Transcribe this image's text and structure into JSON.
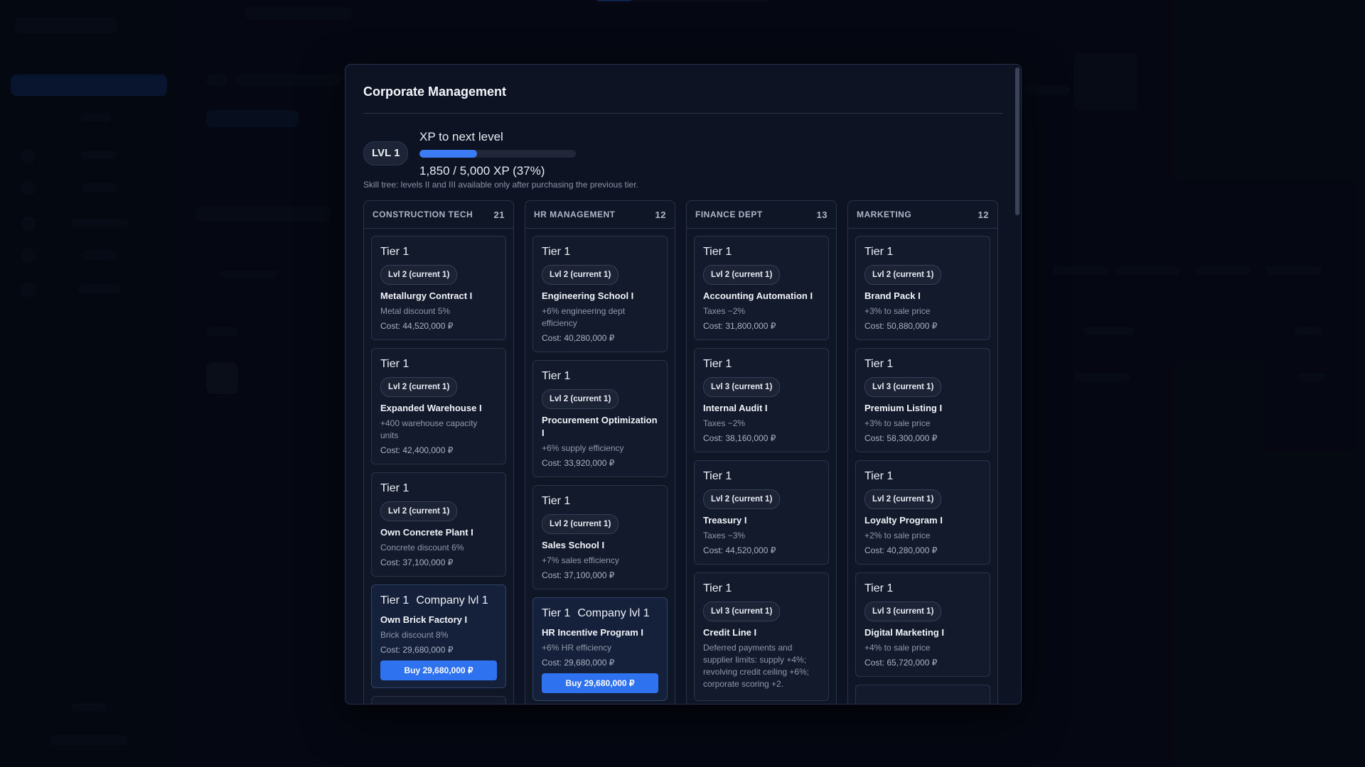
{
  "modal": {
    "title": "Corporate Management",
    "level_badge": "LVL 1",
    "xp_label": "XP to next level",
    "xp_value": "1,850 / 5,000 XP (37%)",
    "xp_progress": 0.37,
    "skill_note": "Skill tree: levels II and III available only after purchasing the previous tier."
  },
  "colors": {
    "accent": "#3b7cf5",
    "buy_button": "#2f72f0",
    "modal_bg": "#0d1322"
  },
  "columns": [
    {
      "title": "CONSTRUCTION TECH",
      "count": "21",
      "cards": [
        {
          "tier": "Tier 1",
          "badge": "Lvl 2 (current 1)",
          "name": "Metallurgy Contract I",
          "desc": "Metal discount 5%",
          "cost": "Cost: 44,520,000 ₽"
        },
        {
          "tier": "Tier 1",
          "badge": "Lvl 2 (current 1)",
          "name": "Expanded Warehouse I",
          "desc": "+400 warehouse capacity units",
          "cost": "Cost: 42,400,000 ₽"
        },
        {
          "tier": "Tier 1",
          "badge": "Lvl 2 (current 1)",
          "name": "Own Concrete Plant I",
          "desc": "Concrete discount 6%",
          "cost": "Cost: 37,100,000 ₽"
        },
        {
          "tier": "Tier 1",
          "company": "Company lvl 1",
          "name": "Own Brick Factory I",
          "desc": "Brick discount 8%",
          "cost": "Cost: 29,680,000 ₽",
          "buy": "Buy 29,680,000 ₽"
        }
      ]
    },
    {
      "title": "HR MANAGEMENT",
      "count": "12",
      "cards": [
        {
          "tier": "Tier 1",
          "badge": "Lvl 2 (current 1)",
          "name": "Engineering School I",
          "desc": "+6% engineering dept efficiency",
          "cost": "Cost: 40,280,000 ₽"
        },
        {
          "tier": "Tier 1",
          "badge": "Lvl 2 (current 1)",
          "name": "Procurement Optimization I",
          "desc": "+6% supply efficiency",
          "cost": "Cost: 33,920,000 ₽"
        },
        {
          "tier": "Tier 1",
          "badge": "Lvl 2 (current 1)",
          "name": "Sales School I",
          "desc": "+7% sales efficiency",
          "cost": "Cost: 37,100,000 ₽"
        },
        {
          "tier": "Tier 1",
          "company": "Company lvl 1",
          "name": "HR Incentive Program I",
          "desc": "+6% HR efficiency",
          "cost": "Cost: 29,680,000 ₽",
          "buy": "Buy 29,680,000 ₽"
        }
      ]
    },
    {
      "title": "FINANCE DEPT",
      "count": "13",
      "cards": [
        {
          "tier": "Tier 1",
          "badge": "Lvl 2 (current 1)",
          "name": "Accounting Automation I",
          "desc": "Taxes −2%",
          "cost": "Cost: 31,800,000 ₽"
        },
        {
          "tier": "Tier 1",
          "badge": "Lvl 3 (current 1)",
          "name": "Internal Audit I",
          "desc": "Taxes −2%",
          "cost": "Cost: 38,160,000 ₽"
        },
        {
          "tier": "Tier 1",
          "badge": "Lvl 2 (current 1)",
          "name": "Treasury I",
          "desc": "Taxes −3%",
          "cost": "Cost: 44,520,000 ₽"
        },
        {
          "tier": "Tier 1",
          "badge": "Lvl 3 (current 1)",
          "name": "Credit Line I",
          "desc": "Deferred payments and supplier limits: supply +4%; revolving credit ceiling +6%; corporate scoring +2.",
          "cost": ""
        }
      ]
    },
    {
      "title": "MARKETING",
      "count": "12",
      "cards": [
        {
          "tier": "Tier 1",
          "badge": "Lvl 2 (current 1)",
          "name": "Brand Pack I",
          "desc": "+3% to sale price",
          "cost": "Cost: 50,880,000 ₽"
        },
        {
          "tier": "Tier 1",
          "badge": "Lvl 3 (current 1)",
          "name": "Premium Listing I",
          "desc": "+3% to sale price",
          "cost": "Cost: 58,300,000 ₽"
        },
        {
          "tier": "Tier 1",
          "badge": "Lvl 2 (current 1)",
          "name": "Loyalty Program I",
          "desc": "+2% to sale price",
          "cost": "Cost: 40,280,000 ₽"
        },
        {
          "tier": "Tier 1",
          "badge": "Lvl 3 (current 1)",
          "name": "Digital Marketing I",
          "desc": "+4% to sale price",
          "cost": "Cost: 65,720,000 ₽"
        }
      ]
    }
  ]
}
